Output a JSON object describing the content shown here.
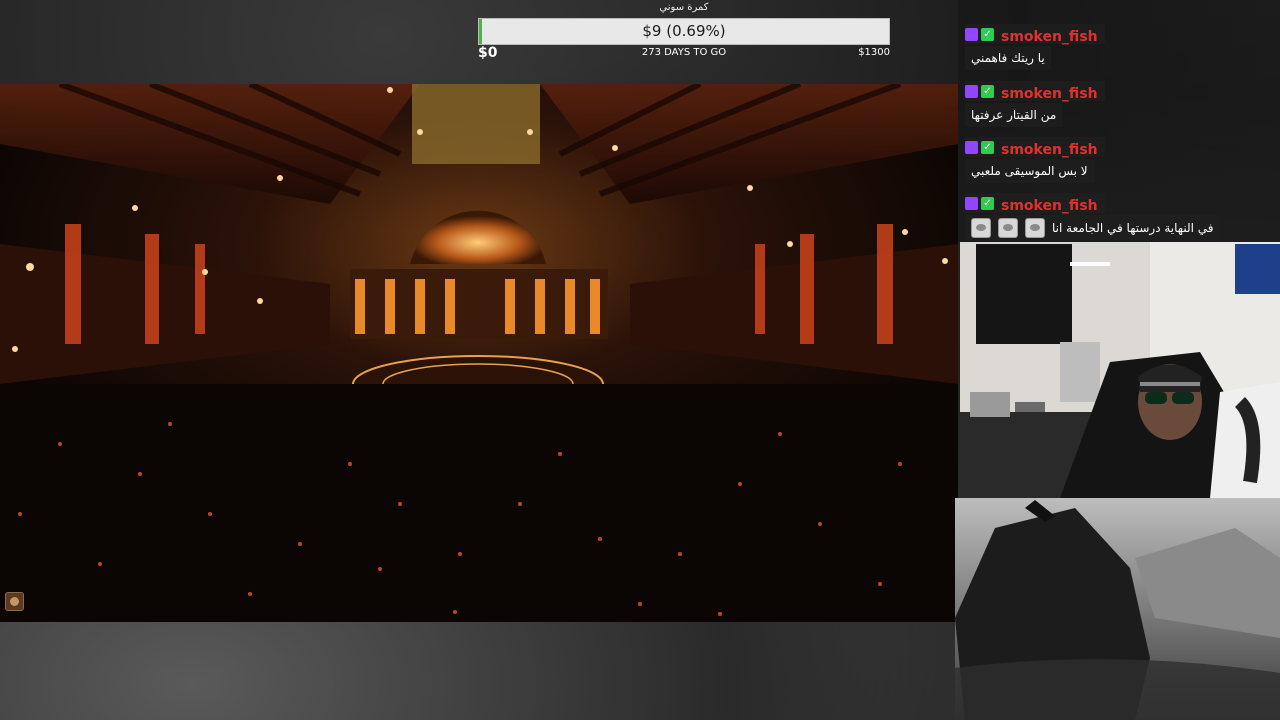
{
  "goal": {
    "title": "كمرة سوني",
    "bar_text": "$9 (0.69%)",
    "progress_percent": 0.69,
    "start_amount": "$0",
    "days_left": "273 DAYS TO GO",
    "target_amount": "$1300"
  },
  "chat": {
    "messages": [
      {
        "username": "smoken_fish",
        "text": "يا ريتك فاهمني",
        "emotes": 0
      },
      {
        "username": "smoken_fish",
        "text": "من القيتار عرفتها",
        "emotes": 0
      },
      {
        "username": "smoken_fish",
        "text": "لا بس الموسيقى ملعبي",
        "emotes": 0
      },
      {
        "username": "smoken_fish",
        "text": "في النهاية درستها في الجامعة انا",
        "emotes": 3
      }
    ],
    "badges": [
      "twitch-badge-icon",
      "verified-check-icon"
    ]
  },
  "video": {
    "description_icon": "channel-avatar-icon"
  },
  "colors": {
    "username": "#e0312e",
    "goal_fill": "#4fb14f",
    "twitch_purple": "#9147ff",
    "check_green": "#2ecc52"
  }
}
